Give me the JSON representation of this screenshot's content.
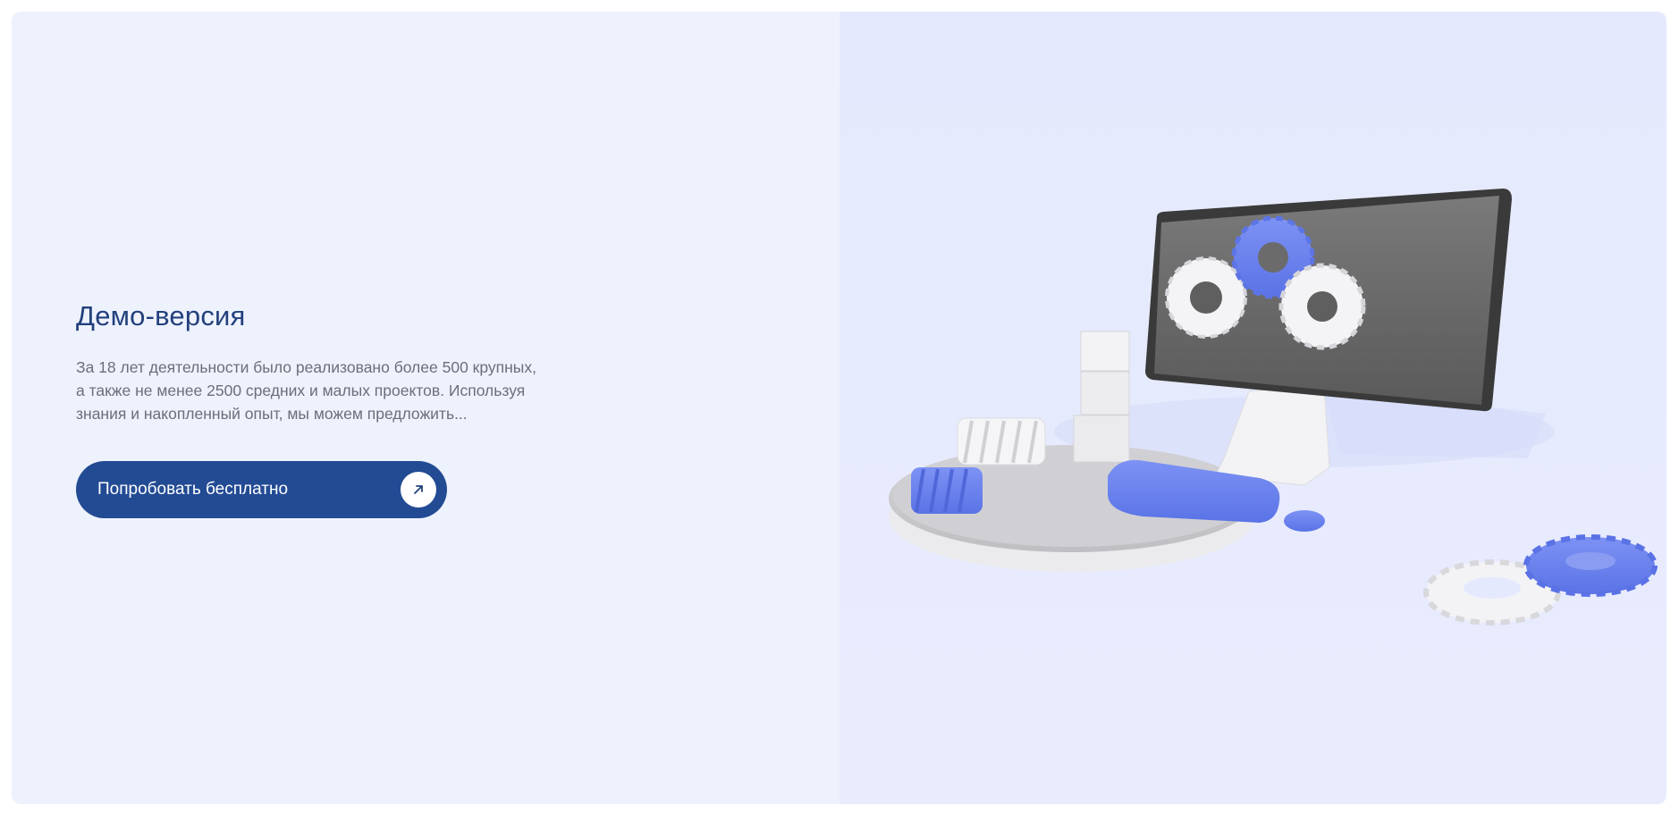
{
  "promo": {
    "title": "Демо-версия",
    "description_lines": [
      "За 18 лет деятельности было реализовано более 500 крупных,",
      "а также не менее 2500 средних и малых проектов. Используя",
      "знания и накопленный опыт, мы можем предложить..."
    ],
    "cta_label": "Попробовать бесплатно",
    "cta_icon": "arrow-up-right-icon"
  },
  "illustration": {
    "subject": "computer-with-gears",
    "colors": {
      "accent_blue": "#6f86ef",
      "screen": "#6b6b6b",
      "white_parts": "#f4f4f6"
    }
  },
  "colors": {
    "left_bg": "#eef2fd",
    "right_bg": "#e5e9fd",
    "title": "#23407c",
    "text": "#6b6f7a",
    "button": "#234b94"
  }
}
